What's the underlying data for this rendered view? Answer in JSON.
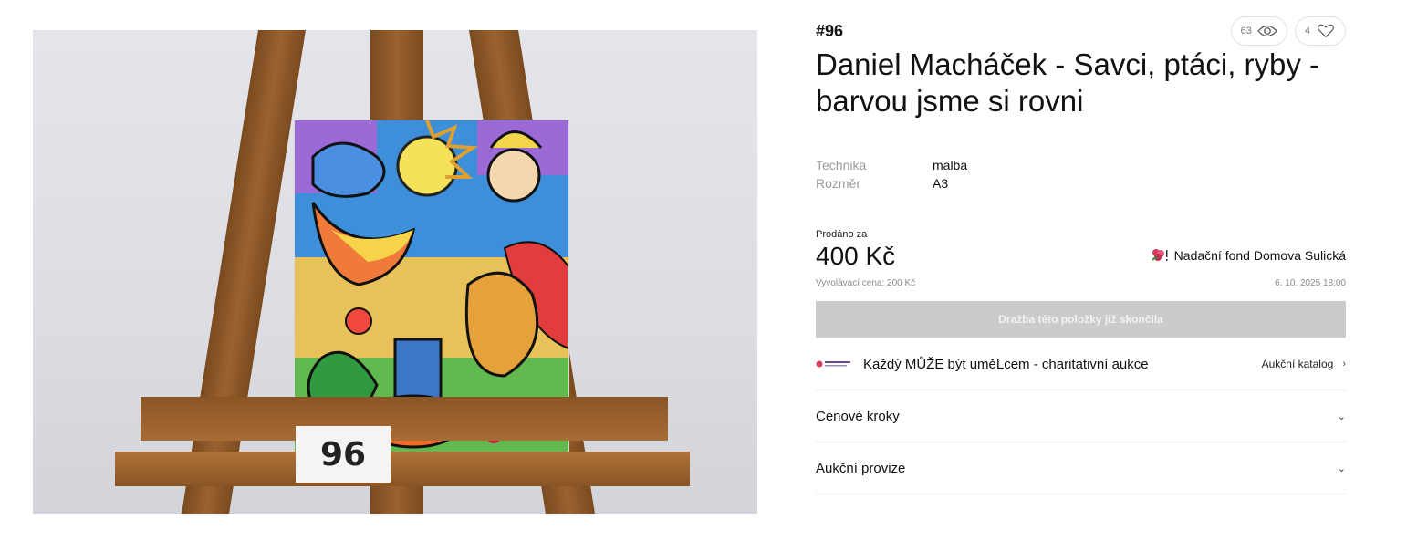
{
  "lot": {
    "number": "#96",
    "title": "Daniel Macháček - Savci, ptáci, ryby - barvou jsme si rovni",
    "views": "63",
    "likes": "4",
    "photo_card": "96"
  },
  "specs": [
    {
      "label": "Technika",
      "value": "malba"
    },
    {
      "label": "Rozměr",
      "value": "A3"
    }
  ],
  "sale": {
    "sold_label": "Prodáno za",
    "price": "400 Kč",
    "starting_price": "Vyvolávací cena: 200 Kč",
    "end_date": "6. 10. 2025 18:00",
    "foundation": "Nadační fond Domova Sulická",
    "ended_button": "Dražba této položky již skončila"
  },
  "rows": {
    "auction_name": "Každý MŮŽE být uměLcem - charitativní aukce",
    "catalog_link": "Aukční katalog",
    "price_steps": "Cenové kroky",
    "commission": "Aukční provize"
  },
  "colors": {
    "accent_disabled": "#cbcbcb",
    "flower": "#d63a5a"
  }
}
